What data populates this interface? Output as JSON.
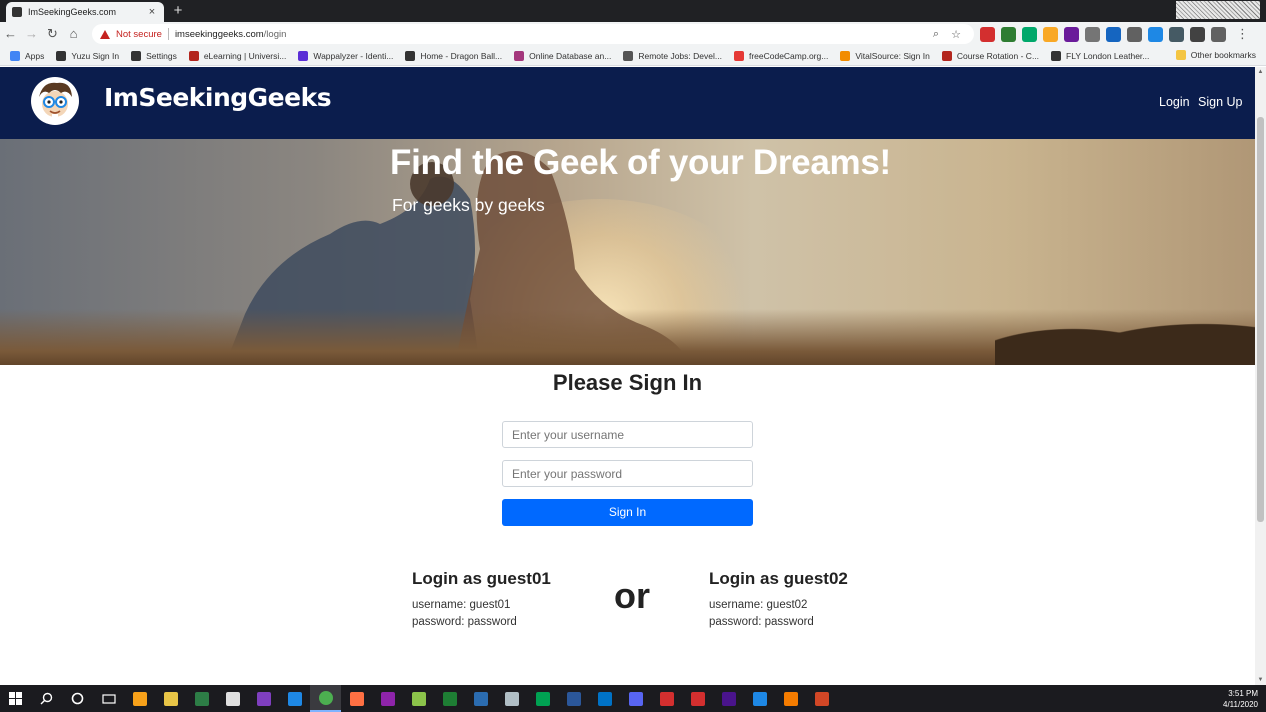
{
  "browser": {
    "tab_title": "ImSeekingGeeks.com",
    "close_glyph": "×",
    "new_tab_glyph": "+",
    "security_label": "Not secure",
    "url_host": "imseekinggeeks.com",
    "url_path": "/login",
    "bookmarks": [
      {
        "label": "Apps",
        "color": "#4285f4"
      },
      {
        "label": "Yuzu Sign In",
        "color": "#333333"
      },
      {
        "label": "Settings",
        "color": "#333333"
      },
      {
        "label": "eLearning | Universi...",
        "color": "#b3261e"
      },
      {
        "label": "Wappalyzer - Identi...",
        "color": "#5b2ed6"
      },
      {
        "label": "Home - Dragon Ball...",
        "color": "#333333"
      },
      {
        "label": "Online Database an...",
        "color": "#a4377c"
      },
      {
        "label": "Remote Jobs: Devel...",
        "color": "#555555"
      },
      {
        "label": "freeCodeCamp.org...",
        "color": "#e53935"
      },
      {
        "label": "VitalSource: Sign In",
        "color": "#f28c00"
      },
      {
        "label": "Course Rotation - C...",
        "color": "#b3261e"
      },
      {
        "label": "FLY London Leather...",
        "color": "#333333"
      }
    ],
    "other_bookmarks": "Other bookmarks",
    "extension_colors": [
      "#d32f2f",
      "#2e7d32",
      "#00a86b",
      "#f9a825",
      "#6a1b9a",
      "#757575",
      "#1565c0",
      "#616161",
      "#1e88e5",
      "#455a64",
      "#424242",
      "#616161"
    ]
  },
  "site": {
    "brand": "ImSeekingGeeks",
    "nav": {
      "login": "Login",
      "signup": "Sign Up"
    },
    "hero": {
      "title": "Find the Geek of your Dreams!",
      "subtitle": "For geeks by geeks"
    },
    "signin": {
      "title": "Please Sign In",
      "username_placeholder": "Enter your username",
      "password_placeholder": "Enter your password",
      "button": "Sign In"
    },
    "guest1": {
      "heading": "Login as guest01",
      "username": "username: guest01",
      "password": "password: password"
    },
    "guest2": {
      "heading": "Login as guest02",
      "username": "username: guest02",
      "password": "password: password"
    },
    "or": "or"
  },
  "taskbar": {
    "time": "3:51 PM",
    "date": "4/11/2020",
    "app_colors": [
      "#f7a11a",
      "#e8c547",
      "#2d7d46",
      "#e0e0e0",
      "#7f3fbf",
      "#1e88e5",
      "#4caf50",
      "#ff7043",
      "#8e24aa",
      "#8bc34a",
      "#1e7e34",
      "#2b6cb0",
      "#b0bec5",
      "#00a152",
      "#2b579a",
      "#0072c6",
      "#5865f2",
      "#d32f2f",
      "#d32f2f",
      "#4a148c",
      "#1e88e5",
      "#f57c00",
      "#d24726"
    ]
  }
}
